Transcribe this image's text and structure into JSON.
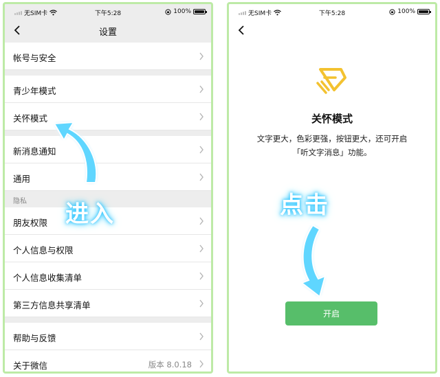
{
  "status_bar": {
    "carrier": "无SIM卡",
    "time": "下午5:28",
    "battery": "100%"
  },
  "left_screen": {
    "title": "设置",
    "items": [
      {
        "label": "帐号与安全"
      },
      {
        "label": "青少年模式"
      },
      {
        "label": "关怀模式"
      },
      {
        "label": "新消息通知"
      },
      {
        "label": "通用"
      },
      {
        "label": "朋友权限"
      },
      {
        "label": "个人信息与权限"
      },
      {
        "label": "个人信息收集清单"
      },
      {
        "label": "第三方信息共享清单"
      },
      {
        "label": "帮助与反馈"
      },
      {
        "label": "关于微信",
        "value": "版本 8.0.18"
      }
    ],
    "section_privacy": "隐私",
    "annotation": "进入"
  },
  "right_screen": {
    "title": "关怀模式",
    "description_line1": "文字更大，色彩更强，按钮更大，还可开启",
    "description_line2": "「听文字消息」功能。",
    "enable_button": "开启",
    "annotation": "点击"
  },
  "colors": {
    "accent": "#57be6a",
    "frame": "#bdeaa6",
    "glow": "#2ec5ff",
    "icon": "#f3c230"
  },
  "icons": [
    "wifi-icon",
    "signal-icon",
    "battery-icon",
    "lock-rotation-icon",
    "back-chevron-icon",
    "chevron-right-icon",
    "care-mode-icon"
  ]
}
